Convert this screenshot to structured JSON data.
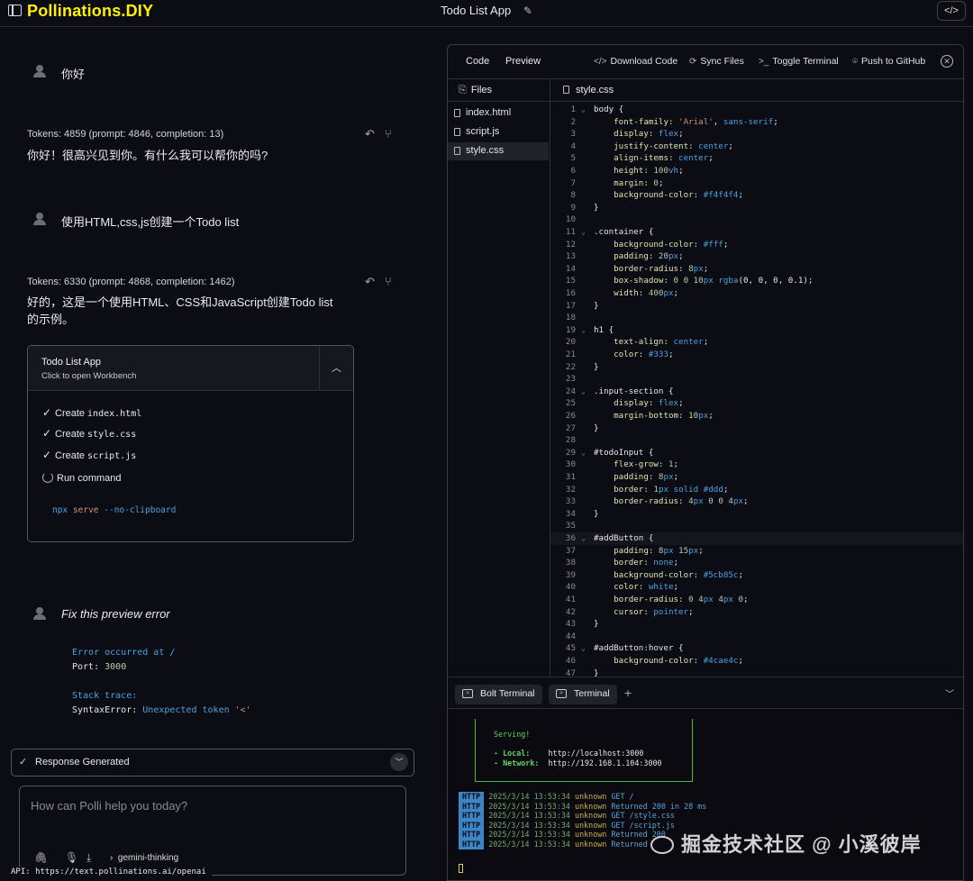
{
  "header": {
    "brand": "Pollinations.DIY",
    "title": "Todo List App"
  },
  "chat": {
    "messages": [
      {
        "user": "你好",
        "tokens": "Tokens: 4859 (prompt: 4846, completion: 13)",
        "reply": "你好！很高兴见到你。有什么我可以帮你的吗?"
      },
      {
        "user": "使用HTML,css,js创建一个Todo list",
        "tokens": "Tokens: 6330 (prompt: 4868, completion: 1462)",
        "reply": "好的，这是一个使用HTML、CSS和JavaScript创建Todo list的示例。"
      }
    ],
    "artifact": {
      "title": "Todo List App",
      "subtitle": "Click to open Workbench",
      "steps": [
        {
          "action": "Create",
          "file": "index.html"
        },
        {
          "action": "Create",
          "file": "style.css"
        },
        {
          "action": "Create",
          "file": "script.js"
        }
      ],
      "run_label": "Run command",
      "command": {
        "bin": "npx",
        "arg": "serve",
        "flag": "--no-clipboard"
      }
    },
    "fix_message": "Fix this preview error",
    "error": {
      "line1": "Error occurred at /",
      "port_label": "Port:",
      "port_value": "3000",
      "stack_label": "Stack trace:",
      "syntax_label": "SyntaxError:",
      "syntax_msg": "Unexpected token",
      "syntax_tok": "'<'"
    },
    "response_status": "Response Generated",
    "input": {
      "placeholder": "How can Polli help you today?",
      "model": "gemini-thinking"
    },
    "api_line": "API: https://text.pollinations.ai/openai"
  },
  "workbench": {
    "tabs": [
      "Code",
      "Preview"
    ],
    "actions": [
      "Download Code",
      "Sync Files",
      "Toggle Terminal",
      "Push to GitHub"
    ],
    "files_label": "Files",
    "files": [
      "index.html",
      "script.js",
      "style.css"
    ],
    "active_file": "style.css",
    "terminal_tabs": [
      "Bolt Terminal",
      "Terminal"
    ],
    "serving": {
      "title": "Serving!",
      "local_label": "- Local:",
      "local_url": "http://localhost:3000",
      "network_label": "- Network:",
      "network_url": "http://192.168.1.104:3000"
    },
    "logs": [
      {
        "tag": "HTTP",
        "time": "2025/3/14 13:53:34",
        "who": "unknown",
        "msg": "GET /"
      },
      {
        "tag": "HTTP",
        "time": "2025/3/14 13:53:34",
        "who": "unknown",
        "msg": "Returned 200 in 28 ms"
      },
      {
        "tag": "HTTP",
        "time": "2025/3/14 13:53:34",
        "who": "unknown",
        "msg": "GET /style.css"
      },
      {
        "tag": "HTTP",
        "time": "2025/3/14 13:53:34",
        "who": "unknown",
        "msg": "GET /script.js"
      },
      {
        "tag": "HTTP",
        "time": "2025/3/14 13:53:34",
        "who": "unknown",
        "msg": "Returned 200"
      },
      {
        "tag": "HTTP",
        "time": "2025/3/14 13:53:34",
        "who": "unknown",
        "msg": "Returned"
      }
    ]
  },
  "code_lines": [
    [
      [
        "sel",
        "body {"
      ]
    ],
    [
      [
        "prop",
        "    font-family: "
      ],
      [
        "str",
        "'Arial'"
      ],
      [
        "sel",
        ", "
      ],
      [
        "val",
        "sans-serif"
      ],
      [
        "sel",
        ";"
      ]
    ],
    [
      [
        "prop",
        "    display: "
      ],
      [
        "val",
        "flex"
      ],
      [
        "sel",
        ";"
      ]
    ],
    [
      [
        "prop",
        "    justify-content: "
      ],
      [
        "val",
        "center"
      ],
      [
        "sel",
        ";"
      ]
    ],
    [
      [
        "prop",
        "    align-items: "
      ],
      [
        "val",
        "center"
      ],
      [
        "sel",
        ";"
      ]
    ],
    [
      [
        "prop",
        "    height: "
      ],
      [
        "num",
        "100"
      ],
      [
        "val",
        "vh"
      ],
      [
        "sel",
        ";"
      ]
    ],
    [
      [
        "prop",
        "    margin: "
      ],
      [
        "num",
        "0"
      ],
      [
        "sel",
        ";"
      ]
    ],
    [
      [
        "prop",
        "    background-color: "
      ],
      [
        "val",
        "#f4f4f4"
      ],
      [
        "sel",
        ";"
      ]
    ],
    [
      [
        "sel",
        "}"
      ]
    ],
    [
      [
        "sel",
        ""
      ]
    ],
    [
      [
        "sel",
        ".container {"
      ]
    ],
    [
      [
        "prop",
        "    background-color: "
      ],
      [
        "val",
        "#fff"
      ],
      [
        "sel",
        ";"
      ]
    ],
    [
      [
        "prop",
        "    padding: "
      ],
      [
        "num",
        "20"
      ],
      [
        "val",
        "px"
      ],
      [
        "sel",
        ";"
      ]
    ],
    [
      [
        "prop",
        "    border-radius: "
      ],
      [
        "num",
        "8"
      ],
      [
        "val",
        "px"
      ],
      [
        "sel",
        ";"
      ]
    ],
    [
      [
        "prop",
        "    box-shadow: "
      ],
      [
        "num",
        "0 0 10"
      ],
      [
        "val",
        "px rgba"
      ],
      [
        "sel",
        "(0, 0, 0, 0.1);"
      ]
    ],
    [
      [
        "prop",
        "    width: "
      ],
      [
        "num",
        "400"
      ],
      [
        "val",
        "px"
      ],
      [
        "sel",
        ";"
      ]
    ],
    [
      [
        "sel",
        "}"
      ]
    ],
    [
      [
        "sel",
        ""
      ]
    ],
    [
      [
        "sel",
        "h1 {"
      ]
    ],
    [
      [
        "prop",
        "    text-align: "
      ],
      [
        "val",
        "center"
      ],
      [
        "sel",
        ";"
      ]
    ],
    [
      [
        "prop",
        "    color: "
      ],
      [
        "val",
        "#333"
      ],
      [
        "sel",
        ";"
      ]
    ],
    [
      [
        "sel",
        "}"
      ]
    ],
    [
      [
        "sel",
        ""
      ]
    ],
    [
      [
        "sel",
        ".input-section {"
      ]
    ],
    [
      [
        "prop",
        "    display: "
      ],
      [
        "val",
        "flex"
      ],
      [
        "sel",
        ";"
      ]
    ],
    [
      [
        "prop",
        "    margin-bottom: "
      ],
      [
        "num",
        "10"
      ],
      [
        "val",
        "px"
      ],
      [
        "sel",
        ";"
      ]
    ],
    [
      [
        "sel",
        "}"
      ]
    ],
    [
      [
        "sel",
        ""
      ]
    ],
    [
      [
        "sel",
        "#todoInput {"
      ]
    ],
    [
      [
        "prop",
        "    flex-grow: "
      ],
      [
        "num",
        "1"
      ],
      [
        "sel",
        ";"
      ]
    ],
    [
      [
        "prop",
        "    padding: "
      ],
      [
        "num",
        "8"
      ],
      [
        "val",
        "px"
      ],
      [
        "sel",
        ";"
      ]
    ],
    [
      [
        "prop",
        "    border: "
      ],
      [
        "num",
        "1"
      ],
      [
        "val",
        "px solid #ddd"
      ],
      [
        "sel",
        ";"
      ]
    ],
    [
      [
        "prop",
        "    border-radius: "
      ],
      [
        "num",
        "4"
      ],
      [
        "val",
        "px "
      ],
      [
        "num",
        "0 0 4"
      ],
      [
        "val",
        "px"
      ],
      [
        "sel",
        ";"
      ]
    ],
    [
      [
        "sel",
        "}"
      ]
    ],
    [
      [
        "sel",
        ""
      ]
    ],
    [
      [
        "sel",
        "#addButton {"
      ]
    ],
    [
      [
        "prop",
        "    padding: "
      ],
      [
        "num",
        "8"
      ],
      [
        "val",
        "px "
      ],
      [
        "num",
        "15"
      ],
      [
        "val",
        "px"
      ],
      [
        "sel",
        ";"
      ]
    ],
    [
      [
        "prop",
        "    border: "
      ],
      [
        "val",
        "none"
      ],
      [
        "sel",
        ";"
      ]
    ],
    [
      [
        "prop",
        "    background-color: "
      ],
      [
        "val",
        "#5cb85c"
      ],
      [
        "sel",
        ";"
      ]
    ],
    [
      [
        "prop",
        "    color: "
      ],
      [
        "val",
        "white"
      ],
      [
        "sel",
        ";"
      ]
    ],
    [
      [
        "prop",
        "    border-radius: "
      ],
      [
        "num",
        "0 4"
      ],
      [
        "val",
        "px "
      ],
      [
        "num",
        "4"
      ],
      [
        "val",
        "px "
      ],
      [
        "num",
        "0"
      ],
      [
        "sel",
        ";"
      ]
    ],
    [
      [
        "prop",
        "    cursor: "
      ],
      [
        "val",
        "pointer"
      ],
      [
        "sel",
        ";"
      ]
    ],
    [
      [
        "sel",
        "}"
      ]
    ],
    [
      [
        "sel",
        ""
      ]
    ],
    [
      [
        "sel",
        "#addButton:hover {"
      ]
    ],
    [
      [
        "prop",
        "    background-color: "
      ],
      [
        "val",
        "#4cae4c"
      ],
      [
        "sel",
        ";"
      ]
    ],
    [
      [
        "sel",
        "}"
      ]
    ]
  ],
  "colors": {
    "brand": "#fff200",
    "background": "#0c0c14",
    "accent_blue": "#4aa3df",
    "terminal_green": "#5fd35f"
  },
  "watermark": "掘金技术社区 @ 小溪彼岸"
}
